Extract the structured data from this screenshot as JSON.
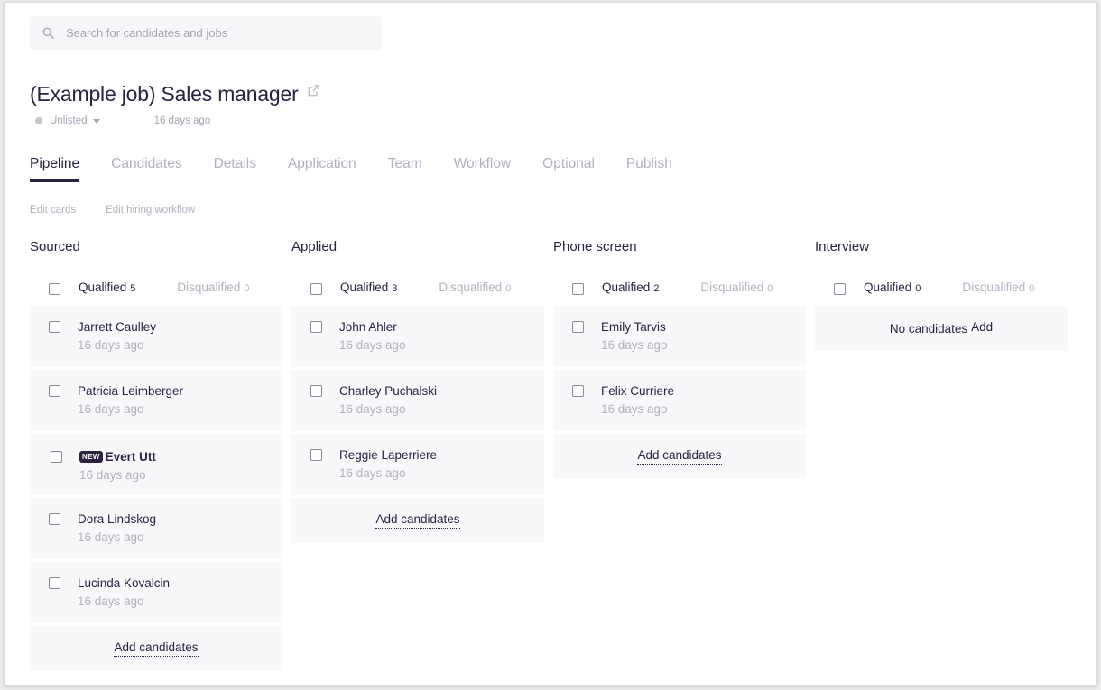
{
  "search": {
    "placeholder": "Search for candidates and jobs"
  },
  "job": {
    "title": "(Example job) Sales manager",
    "status": "Unlisted",
    "created": "16 days ago"
  },
  "tabs": [
    "Pipeline",
    "Candidates",
    "Details",
    "Application",
    "Team",
    "Workflow",
    "Optional",
    "Publish"
  ],
  "links": {
    "edit_cards": "Edit cards",
    "edit_workflow": "Edit hiring workflow"
  },
  "labels": {
    "qualified": "Qualified",
    "disqualified": "Disqualified",
    "add_candidates": "Add candidates",
    "no_candidates": "No candidates",
    "add": "Add",
    "new_badge": "NEW"
  },
  "columns": [
    {
      "title": "Sourced",
      "qualified": "5",
      "disqualified": "0",
      "candidates": [
        {
          "name": "Jarrett Caulley",
          "time": "16 days ago"
        },
        {
          "name": "Patricia Leimberger",
          "time": "16 days ago"
        },
        {
          "name": "Evert Utt",
          "time": "16 days ago"
        },
        {
          "name": "Dora Lindskog",
          "time": "16 days ago"
        },
        {
          "name": "Lucinda Kovalcin",
          "time": "16 days ago"
        }
      ]
    },
    {
      "title": "Applied",
      "qualified": "3",
      "disqualified": "0",
      "candidates": [
        {
          "name": "John Ahler",
          "time": "16 days ago"
        },
        {
          "name": "Charley Puchalski",
          "time": "16 days ago"
        },
        {
          "name": "Reggie Laperriere",
          "time": "16 days ago"
        }
      ]
    },
    {
      "title": "Phone screen",
      "qualified": "2",
      "disqualified": "0",
      "candidates": [
        {
          "name": "Emily Tarvis",
          "time": "16 days ago"
        },
        {
          "name": "Felix Curriere",
          "time": "16 days ago"
        }
      ]
    },
    {
      "title": "Interview",
      "qualified": "0",
      "disqualified": "0",
      "candidates": []
    }
  ],
  "colors": {
    "primary": "#2b2141",
    "muted": "#b3b0bd",
    "card_bg": "#f8f8fa"
  },
  "icons": {
    "search": "search-icon",
    "external": "external-link-icon"
  }
}
